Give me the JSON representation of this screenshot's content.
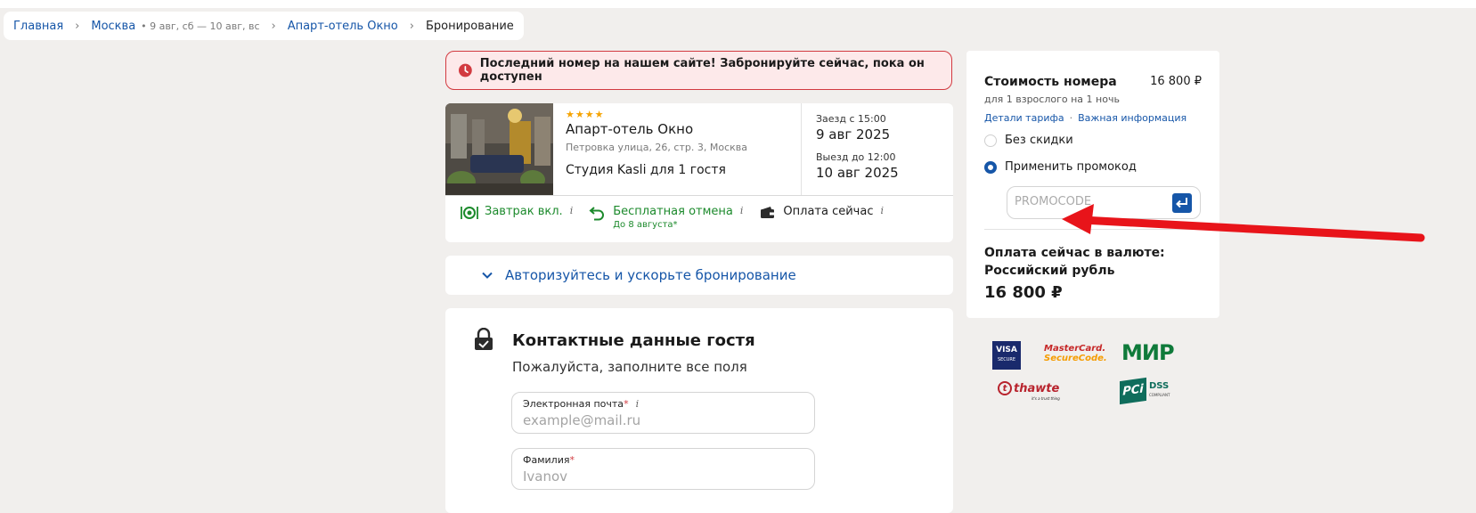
{
  "breadcrumb": {
    "home": "Главная",
    "city": "Москва",
    "dates": "• 9 авг, сб — 10 авг, вс",
    "hotel": "Апарт-отель Окно",
    "current": "Бронирование"
  },
  "alert": {
    "text": "Последний номер на нашем сайте! Забронируйте сейчас, пока он доступен",
    "icon": "clock-icon",
    "color": "#d23a40"
  },
  "hotel": {
    "stars": "★★★★",
    "name": "Апарт-отель Окно",
    "address": "Петровка улица, 26, стр. 3, Москва",
    "room": "Студия Kasli для 1 гостя",
    "checkin_label": "Заезд с 15:00",
    "checkin_date": "9 авг 2025",
    "checkout_label": "Выезд до 12:00",
    "checkout_date": "10 авг 2025"
  },
  "features": {
    "breakfast": "Завтрак вкл.",
    "cancel": "Бесплатная отмена",
    "cancel_note": "До 8 августа*",
    "payment": "Оплата сейчас",
    "info": "i"
  },
  "auth": {
    "text": "Авторизуйтесь и ускорьте бронирование"
  },
  "contact": {
    "title": "Контактные данные гостя",
    "subtitle": "Пожалуйста, заполните все поля",
    "email_label": "Электронная почта",
    "email_placeholder": "example@mail.ru",
    "surname_label": "Фамилия",
    "surname_placeholder": "Ivanov",
    "required_mark": "*"
  },
  "price": {
    "title": "Стоимость номера",
    "amount": "16 800 ₽",
    "for": "для 1 взрослого на 1 ночь",
    "link_tariff": "Детали тарифа",
    "link_dot": "·",
    "link_info": "Важная информация",
    "option_no_discount": "Без скидки",
    "option_promo": "Применить промокод",
    "promo_placeholder": "PROMOCODE",
    "currency_text": "Оплата сейчас в валюте: Российский рубль",
    "total": "16 800 ₽"
  },
  "logos": {
    "visa": "VISA",
    "visa_sub": "SECURE",
    "mc_line1": "MasterCard.",
    "mc_line2": "SecureCode.",
    "mir": "МИР",
    "thawte": "thawte",
    "thawte_sub": "it's a trust thing",
    "pci": "PCi",
    "dss": "DSS",
    "dss_sub": "COMPLIANT"
  },
  "colors": {
    "link": "#1656a8",
    "green": "#1c8a2c",
    "annotation_arrow": "#e8141a"
  }
}
